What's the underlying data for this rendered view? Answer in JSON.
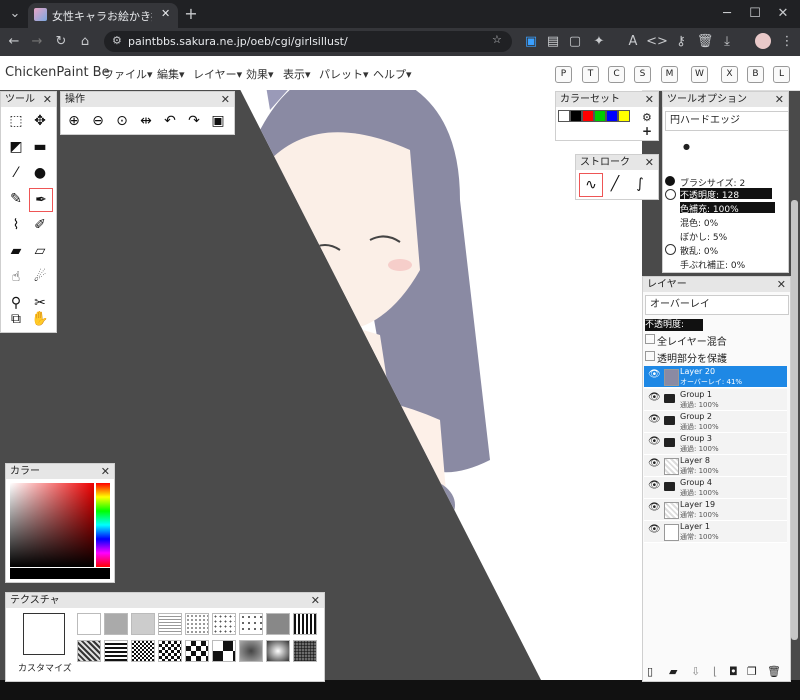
{
  "browser": {
    "tab_title": "女性キャラお絵かき掲示板 - Petit",
    "url": "paintbbs.sakura.ne.jp/oeb/cgi/girlsillust/",
    "new_tab": "+",
    "tab_close": "✕"
  },
  "app": {
    "title": "ChickenPaint Be",
    "menus": [
      "ファイル▾",
      "編集▾",
      "レイヤー▾",
      "効果▾",
      "表示▾",
      "パレット▾",
      "ヘルプ▾"
    ],
    "shortcuts": [
      "P",
      "T",
      "C",
      "S",
      "M",
      "W",
      "X",
      "B",
      "L"
    ]
  },
  "tools_panel": {
    "title": "ツール",
    "close": "✕"
  },
  "ops_panel": {
    "title": "操作",
    "close": "✕"
  },
  "colorset_panel": {
    "title": "カラーセット",
    "close": "✕",
    "swatches": [
      "#ffffff",
      "#000000",
      "#ff0000",
      "#00cc00",
      "#0000ff",
      "#ffff00"
    ]
  },
  "stroke_panel": {
    "title": "ストローク",
    "close": "✕"
  },
  "tool_options": {
    "title": "ツールオプション",
    "close": "✕",
    "brush_name": "円ハードエッジ",
    "brush_size": "ブラシサイズ: 2",
    "opacity": "不透明度: 128",
    "color_fill": "色補充: 100%",
    "blend": "混色: 0%",
    "blur": "ぼかし: 5%",
    "scatter": "散乱: 0%",
    "smoothing": "手ぶれ補正: 0%"
  },
  "layers_panel": {
    "title": "レイヤー",
    "close": "✕",
    "blend_mode": "オーバーレイ",
    "opacity": "不透明度: 41%",
    "clip_all": "全レイヤー混合",
    "protect_alpha": "透明部分を保護",
    "layers": [
      {
        "name": "Layer 20",
        "mode": "オーバーレイ: 41%",
        "type": "layer",
        "selected": true
      },
      {
        "name": "Group 1",
        "mode": "通過: 100%",
        "type": "group",
        "selected": false
      },
      {
        "name": "Group 2",
        "mode": "通過: 100%",
        "type": "group",
        "selected": false
      },
      {
        "name": "Group 3",
        "mode": "通過: 100%",
        "type": "group",
        "selected": false
      },
      {
        "name": "Layer 8",
        "mode": "通常: 100%",
        "type": "layer",
        "selected": false
      },
      {
        "name": "Group 4",
        "mode": "通過: 100%",
        "type": "group",
        "selected": false
      },
      {
        "name": "Layer 19",
        "mode": "通常: 100%",
        "type": "layer",
        "selected": false
      },
      {
        "name": "Layer 1",
        "mode": "通常: 100%",
        "type": "layer",
        "selected": false
      }
    ]
  },
  "color_panel": {
    "title": "カラー",
    "close": "✕"
  },
  "texture_panel": {
    "title": "テクスチャ",
    "close": "✕",
    "customize": "カスタマイズ"
  },
  "colors": {
    "accent": "#1e88e5",
    "panel_header": "#e6e6e6"
  }
}
